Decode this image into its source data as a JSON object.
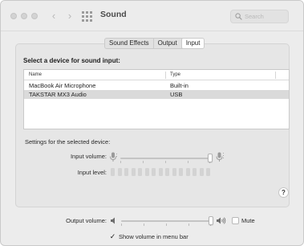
{
  "window": {
    "title": "Sound"
  },
  "search": {
    "placeholder": "Search"
  },
  "tabs": [
    {
      "label": "Sound Effects",
      "active": false
    },
    {
      "label": "Output",
      "active": false
    },
    {
      "label": "Input",
      "active": true
    }
  ],
  "input_panel": {
    "heading": "Select a device for sound input:",
    "table": {
      "columns": [
        "Name",
        "Type"
      ],
      "rows": [
        {
          "name": "MacBook Air Microphone",
          "type": "Built-in",
          "selected": false
        },
        {
          "name": "TAKSTAR MX3 Audio",
          "type": "USB",
          "selected": true
        }
      ]
    },
    "settings_title": "Settings for the selected device:",
    "input_volume_label": "Input volume:",
    "input_volume_level": 1.0,
    "input_level_label": "Input level:",
    "input_level_segments_lit": 0,
    "input_level_segments_total": 15
  },
  "footer": {
    "output_volume_label": "Output volume:",
    "output_volume_level": 1.0,
    "mute_label": "Mute",
    "mute_checked": false,
    "show_volume_label": "Show volume in menu bar",
    "show_volume_checked": true
  },
  "colors": {
    "window_bg": "#ececec",
    "selected_row": "#dadada",
    "panel_bg": "#e6e6e6"
  }
}
